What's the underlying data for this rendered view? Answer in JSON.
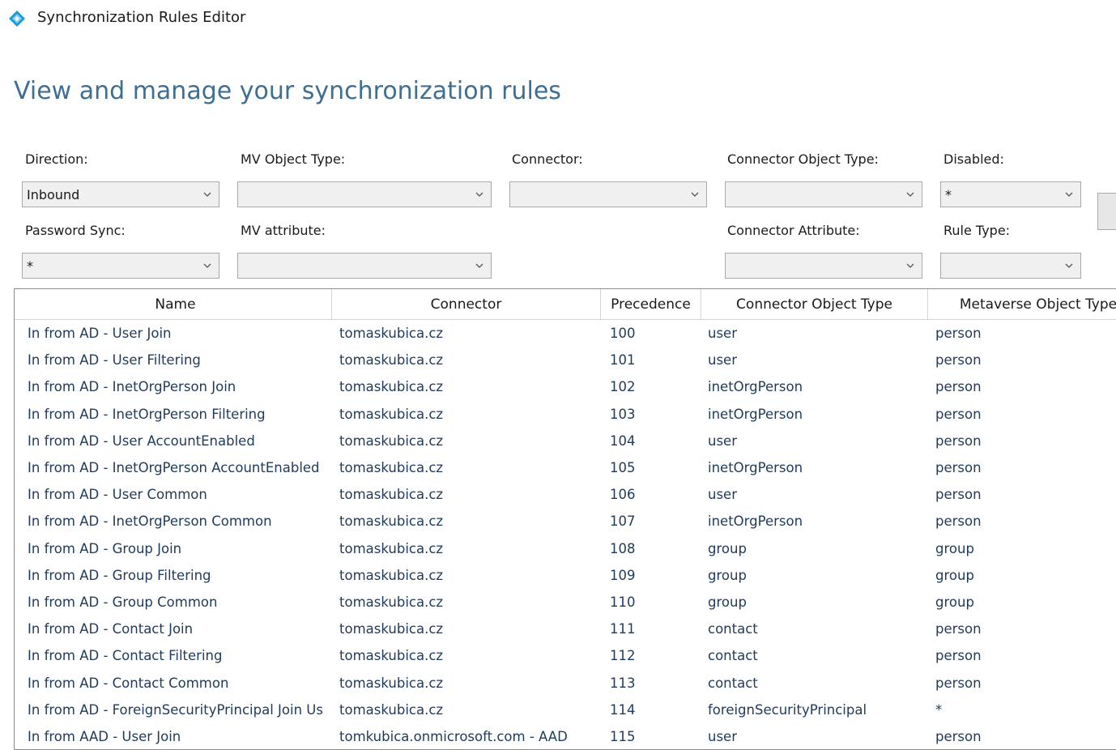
{
  "window": {
    "title": "Synchronization Rules Editor",
    "heading": "View and manage your synchronization rules"
  },
  "filters": {
    "direction": {
      "label": "Direction:",
      "value": "Inbound"
    },
    "mv_object_type": {
      "label": "MV Object Type:",
      "value": ""
    },
    "connector": {
      "label": "Connector:",
      "value": ""
    },
    "connector_object_type": {
      "label": "Connector Object Type:",
      "value": ""
    },
    "disabled": {
      "label": "Disabled:",
      "value": "*"
    },
    "password_sync": {
      "label": "Password Sync:",
      "value": "*"
    },
    "mv_attribute": {
      "label": "MV attribute:",
      "value": ""
    },
    "connector_attribute": {
      "label": "Connector Attribute:",
      "value": ""
    },
    "rule_type": {
      "label": "Rule Type:",
      "value": ""
    }
  },
  "grid": {
    "columns": [
      "Name",
      "Connector",
      "Precedence",
      "Connector Object Type",
      "Metaverse Object Type"
    ],
    "rows": [
      [
        "In from AD - User Join",
        "tomaskubica.cz",
        "100",
        "user",
        "person"
      ],
      [
        "In from AD - User Filtering",
        "tomaskubica.cz",
        "101",
        "user",
        "person"
      ],
      [
        "In from AD - InetOrgPerson Join",
        "tomaskubica.cz",
        "102",
        "inetOrgPerson",
        "person"
      ],
      [
        "In from AD - InetOrgPerson Filtering",
        "tomaskubica.cz",
        "103",
        "inetOrgPerson",
        "person"
      ],
      [
        "In from AD - User AccountEnabled",
        "tomaskubica.cz",
        "104",
        "user",
        "person"
      ],
      [
        "In from AD - InetOrgPerson AccountEnabled",
        "tomaskubica.cz",
        "105",
        "inetOrgPerson",
        "person"
      ],
      [
        "In from AD - User Common",
        "tomaskubica.cz",
        "106",
        "user",
        "person"
      ],
      [
        "In from AD - InetOrgPerson Common",
        "tomaskubica.cz",
        "107",
        "inetOrgPerson",
        "person"
      ],
      [
        "In from AD - Group Join",
        "tomaskubica.cz",
        "108",
        "group",
        "group"
      ],
      [
        "In from AD - Group Filtering",
        "tomaskubica.cz",
        "109",
        "group",
        "group"
      ],
      [
        "In from AD - Group Common",
        "tomaskubica.cz",
        "110",
        "group",
        "group"
      ],
      [
        "In from AD - Contact Join",
        "tomaskubica.cz",
        "111",
        "contact",
        "person"
      ],
      [
        "In from AD - Contact Filtering",
        "tomaskubica.cz",
        "112",
        "contact",
        "person"
      ],
      [
        "In from AD - Contact Common",
        "tomaskubica.cz",
        "113",
        "contact",
        "person"
      ],
      [
        "In from AD - ForeignSecurityPrincipal Join Us",
        "tomaskubica.cz",
        "114",
        "foreignSecurityPrincipal",
        "*"
      ],
      [
        "In from AAD - User Join",
        "tomkubica.onmicrosoft.com - AAD",
        "115",
        "user",
        "person"
      ]
    ]
  },
  "icons": {
    "app": "sync-diamond-icon",
    "dropdown": "chevron-down-icon"
  },
  "colors": {
    "heading": "#3d6f94",
    "row_text": "#1f3a5c",
    "icon_blue": "#1a9bd7"
  }
}
